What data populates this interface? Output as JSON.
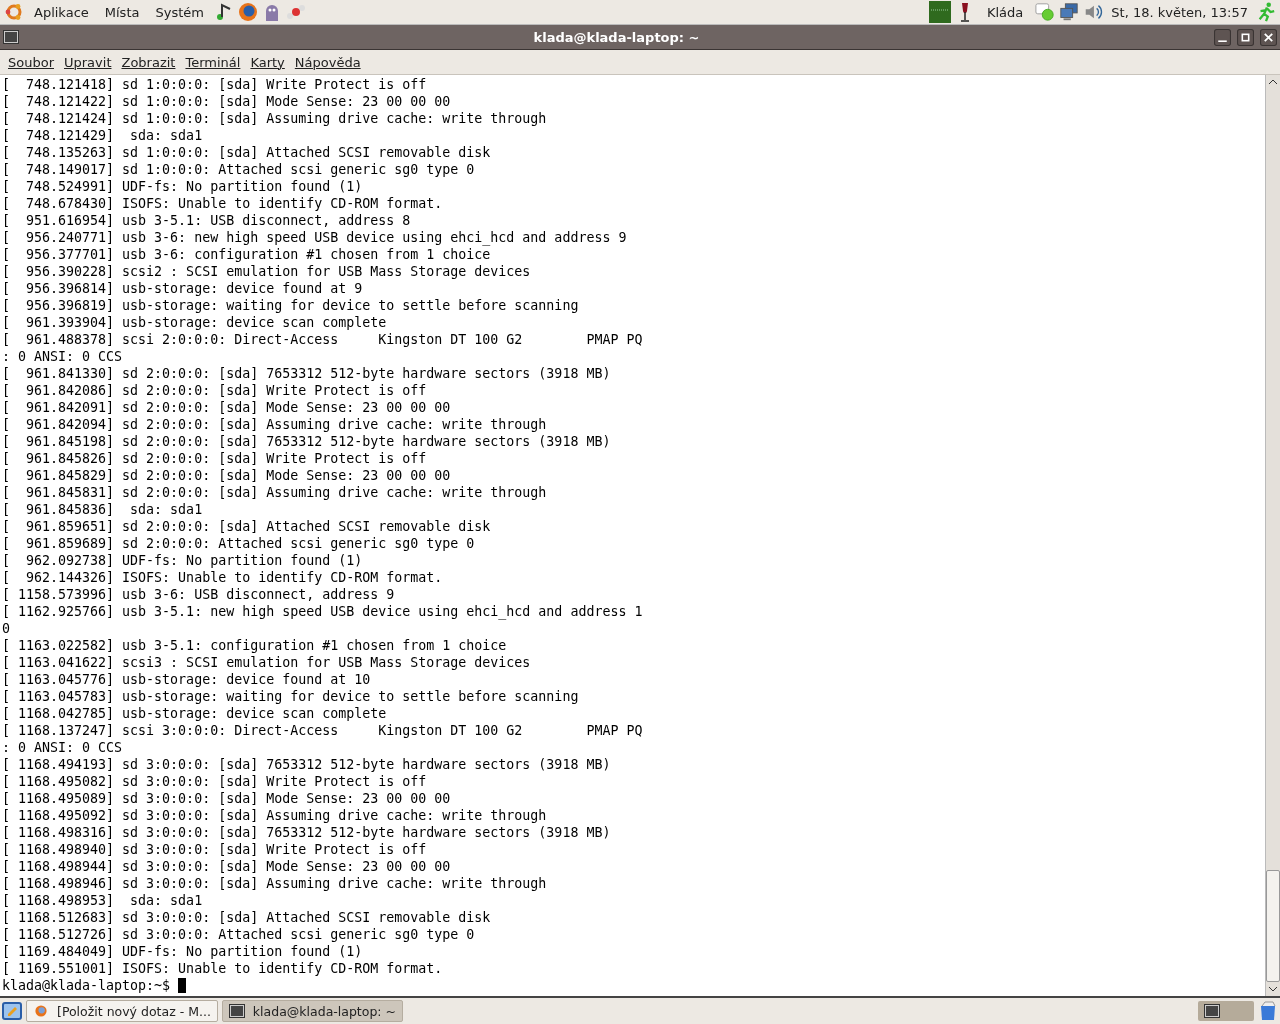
{
  "top_panel": {
    "menus": [
      "Aplikace",
      "Místa",
      "Systém"
    ],
    "user": "Kláda",
    "clock": "St, 18. květen, 13:57"
  },
  "window": {
    "title": "klada@klada-laptop: ~"
  },
  "menubar": [
    "Soubor",
    "Upravit",
    "Zobrazit",
    "Terminál",
    "Karty",
    "Nápověda"
  ],
  "terminal": {
    "lines": [
      "[  748.121418] sd 1:0:0:0: [sda] Write Protect is off",
      "[  748.121422] sd 1:0:0:0: [sda] Mode Sense: 23 00 00 00",
      "[  748.121424] sd 1:0:0:0: [sda] Assuming drive cache: write through",
      "[  748.121429]  sda: sda1",
      "[  748.135263] sd 1:0:0:0: [sda] Attached SCSI removable disk",
      "[  748.149017] sd 1:0:0:0: Attached scsi generic sg0 type 0",
      "[  748.524991] UDF-fs: No partition found (1)",
      "[  748.678430] ISOFS: Unable to identify CD-ROM format.",
      "[  951.616954] usb 3-5.1: USB disconnect, address 8",
      "[  956.240771] usb 3-6: new high speed USB device using ehci_hcd and address 9",
      "[  956.377701] usb 3-6: configuration #1 chosen from 1 choice",
      "[  956.390228] scsi2 : SCSI emulation for USB Mass Storage devices",
      "[  956.396814] usb-storage: device found at 9",
      "[  956.396819] usb-storage: waiting for device to settle before scanning",
      "[  961.393904] usb-storage: device scan complete",
      "[  961.488378] scsi 2:0:0:0: Direct-Access     Kingston DT 100 G2        PMAP PQ",
      ": 0 ANSI: 0 CCS",
      "[  961.841330] sd 2:0:0:0: [sda] 7653312 512-byte hardware sectors (3918 MB)",
      "[  961.842086] sd 2:0:0:0: [sda] Write Protect is off",
      "[  961.842091] sd 2:0:0:0: [sda] Mode Sense: 23 00 00 00",
      "[  961.842094] sd 2:0:0:0: [sda] Assuming drive cache: write through",
      "[  961.845198] sd 2:0:0:0: [sda] 7653312 512-byte hardware sectors (3918 MB)",
      "[  961.845826] sd 2:0:0:0: [sda] Write Protect is off",
      "[  961.845829] sd 2:0:0:0: [sda] Mode Sense: 23 00 00 00",
      "[  961.845831] sd 2:0:0:0: [sda] Assuming drive cache: write through",
      "[  961.845836]  sda: sda1",
      "[  961.859651] sd 2:0:0:0: [sda] Attached SCSI removable disk",
      "[  961.859689] sd 2:0:0:0: Attached scsi generic sg0 type 0",
      "[  962.092738] UDF-fs: No partition found (1)",
      "[  962.144326] ISOFS: Unable to identify CD-ROM format.",
      "[ 1158.573996] usb 3-6: USB disconnect, address 9",
      "[ 1162.925766] usb 3-5.1: new high speed USB device using ehci_hcd and address 1",
      "0",
      "[ 1163.022582] usb 3-5.1: configuration #1 chosen from 1 choice",
      "[ 1163.041622] scsi3 : SCSI emulation for USB Mass Storage devices",
      "[ 1163.045776] usb-storage: device found at 10",
      "[ 1163.045783] usb-storage: waiting for device to settle before scanning",
      "[ 1168.042785] usb-storage: device scan complete",
      "[ 1168.137247] scsi 3:0:0:0: Direct-Access     Kingston DT 100 G2        PMAP PQ",
      ": 0 ANSI: 0 CCS",
      "[ 1168.494193] sd 3:0:0:0: [sda] 7653312 512-byte hardware sectors (3918 MB)",
      "[ 1168.495082] sd 3:0:0:0: [sda] Write Protect is off",
      "[ 1168.495089] sd 3:0:0:0: [sda] Mode Sense: 23 00 00 00",
      "[ 1168.495092] sd 3:0:0:0: [sda] Assuming drive cache: write through",
      "[ 1168.498316] sd 3:0:0:0: [sda] 7653312 512-byte hardware sectors (3918 MB)",
      "[ 1168.498940] sd 3:0:0:0: [sda] Write Protect is off",
      "[ 1168.498944] sd 3:0:0:0: [sda] Mode Sense: 23 00 00 00",
      "[ 1168.498946] sd 3:0:0:0: [sda] Assuming drive cache: write through",
      "[ 1168.498953]  sda: sda1",
      "[ 1168.512683] sd 3:0:0:0: [sda] Attached SCSI removable disk",
      "[ 1168.512726] sd 3:0:0:0: Attached scsi generic sg0 type 0",
      "[ 1169.484049] UDF-fs: No partition found (1)",
      "[ 1169.551001] ISOFS: Unable to identify CD-ROM format."
    ],
    "prompt": "klada@klada-laptop:~$ "
  },
  "taskbar": [
    {
      "label": "[Položit nový dotaz - M...",
      "kind": "browser",
      "selected": false
    },
    {
      "label": "klada@klada-laptop: ~",
      "kind": "terminal",
      "selected": true
    }
  ]
}
